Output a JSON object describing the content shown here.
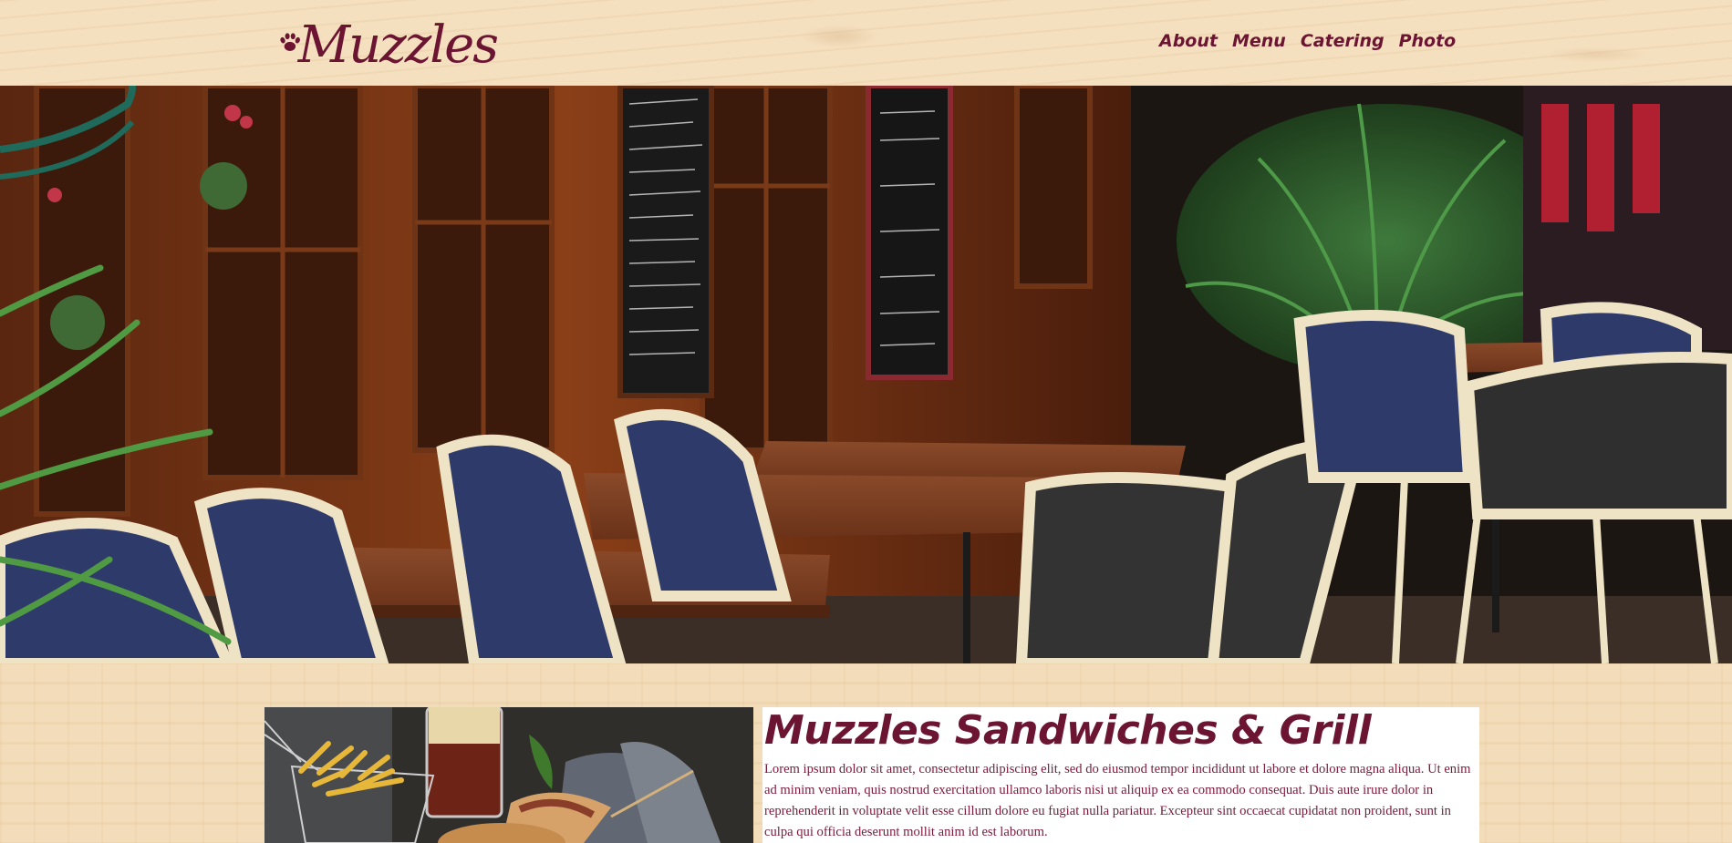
{
  "header": {
    "logo_text": "Muzzles",
    "nav": [
      {
        "label": "About"
      },
      {
        "label": "Menu"
      },
      {
        "label": "Catering"
      },
      {
        "label": "Photo"
      }
    ]
  },
  "hero": {
    "image": "cafe-terrace-photo"
  },
  "content": {
    "title": "Muzzles Sandwiches & Grill",
    "body": "Lorem ipsum dolor sit amet, consectetur adipiscing elit, sed do eiusmod tempor incididunt ut labore et dolore magna aliqua. Ut enim ad minim veniam, quis nostrud exercitation ullamco laboris nisi ut aliquip ex ea commodo consequat. Duis aute irure dolor in reprehenderit in voluptate velit esse cillum dolore eu fugiat nulla pariatur. Excepteur sint occaecat cupidatat non proident, sunt in culpa qui officia deserunt mollit anim id est laborum.",
    "image": "sandwich-fries-photo"
  },
  "colors": {
    "brand": "#6b1533",
    "wood": "#f3dcb9"
  }
}
